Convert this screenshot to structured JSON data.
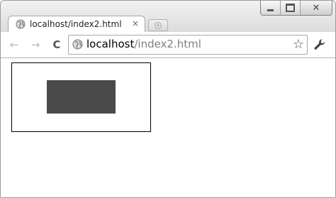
{
  "window": {
    "controls": {
      "minimize_icon": "minimize-icon",
      "maximize_icon": "maximize-icon",
      "close_label": "✕"
    }
  },
  "tab": {
    "title": "localhost/index2.html",
    "close_label": "×",
    "favicon": "globe-icon"
  },
  "new_tab": {
    "icon": "new-tab-icon"
  },
  "toolbar": {
    "back_label": "←",
    "forward_label": "→",
    "reload_label": "C",
    "url_host": "localhost",
    "url_path": "/index2.html",
    "star_label": "☆",
    "menu_icon": "wrench-icon"
  },
  "page": {
    "outer_box_border_color": "#000000",
    "inner_box_fill_color": "#4a4a4a"
  }
}
